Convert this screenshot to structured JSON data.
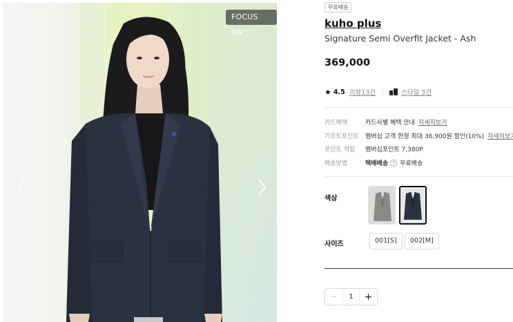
{
  "gallery": {
    "focus_badge": "FOCUS ON :",
    "prev_icon": "chevron-left-icon",
    "next_icon": "chevron-right-icon"
  },
  "product": {
    "free_badge": "무료배송",
    "brand": "kuho plus",
    "name": "Signature Semi Overfit Jacket - Ash",
    "price": "369,000",
    "rating": "4.5",
    "reviews": "리뷰13건",
    "styles": "스타일 3건"
  },
  "benefits": [
    {
      "key": "카드혜택",
      "value": "카드사별 혜택 안내",
      "link": "자세히보기"
    },
    {
      "key": "기프트포인트",
      "value": "멤버십 고객 한정 최대 36,900원 할인(10%)",
      "link": "자세히보기"
    },
    {
      "key": "포인트 적립",
      "value": "멤버십포인트 7,380P"
    },
    {
      "key": "배송방법",
      "value_bold": "택배배송",
      "help": "?",
      "value": "무료배송"
    }
  ],
  "options": {
    "color_label": "색상",
    "size_label": "사이즈",
    "sizes": [
      "001[S]",
      "002[M]"
    ]
  },
  "quantity": {
    "minus": "−",
    "value": "1",
    "plus": "+"
  },
  "colors": {
    "jacket_navy": "#2a3140",
    "jacket_ash": "#8d8a86",
    "selected_border": "#111111"
  }
}
